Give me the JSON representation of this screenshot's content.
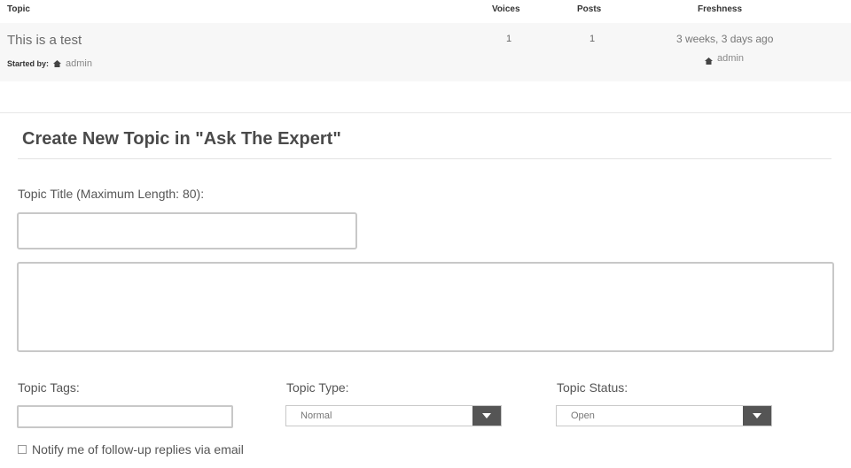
{
  "table": {
    "headers": {
      "topic": "Topic",
      "voices": "Voices",
      "posts": "Posts",
      "freshness": "Freshness"
    },
    "rows": [
      {
        "title": "This is a test",
        "started_by_label": "Started by:",
        "author": "admin",
        "voices": "1",
        "posts": "1",
        "freshness": "3 weeks, 3 days ago",
        "freshness_author": "admin"
      }
    ]
  },
  "form": {
    "heading": "Create New Topic in \"Ask The Expert\"",
    "title_label": "Topic Title (Maximum Length: 80):",
    "title_value": "",
    "content_value": "",
    "tags_label": "Topic Tags:",
    "tags_value": "",
    "type_label": "Topic Type:",
    "type_value": "Normal",
    "status_label": "Topic Status:",
    "status_value": "Open",
    "notify_label": "Notify me of follow-up replies via email",
    "notify_checked": false
  },
  "icons": {
    "avatar": "avatar-icon",
    "dropdown": "chevron-down-icon"
  },
  "colors": {
    "row_bg": "#f7f7f7",
    "select_button": "#555555",
    "border": "#c8c8c8"
  }
}
